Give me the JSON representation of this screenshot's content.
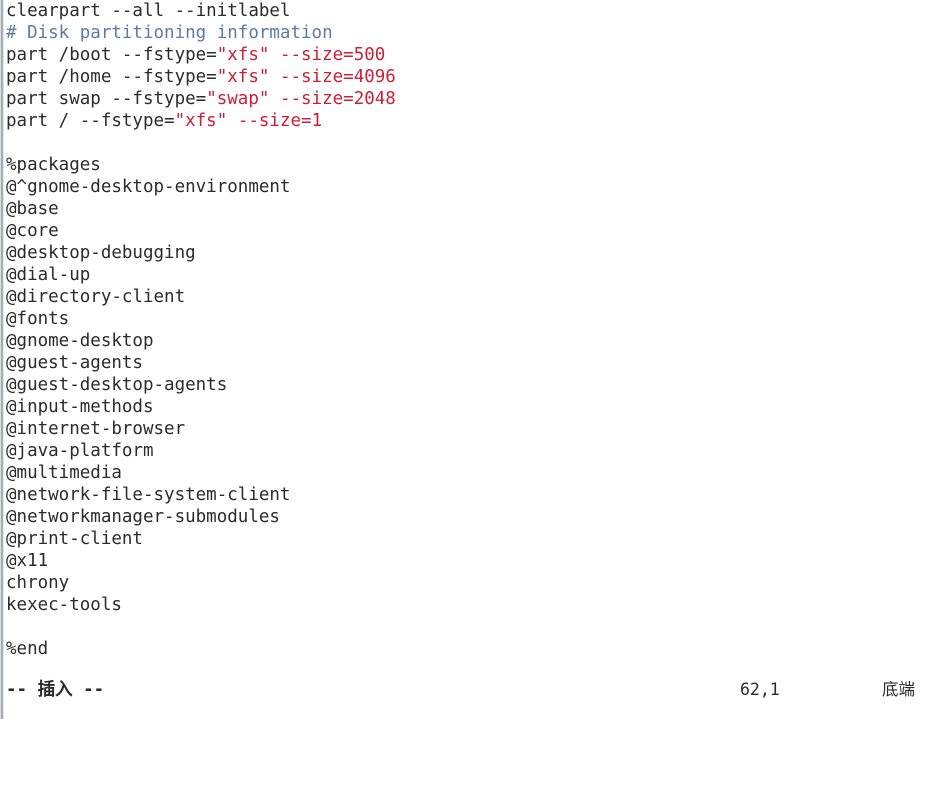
{
  "editor": {
    "name": "vim",
    "background_color": "#ffffff",
    "foreground_color": "#2b2b2b",
    "comment_color": "#5a7ca8",
    "string_color": "#cc1f36",
    "number_color": "#cc1f36",
    "gutter_color": "#8e969f"
  },
  "lines": [
    {
      "id": "line-1",
      "tokens": [
        {
          "text": "clearpart --all --initlabel",
          "type": "plain"
        }
      ]
    },
    {
      "id": "line-2",
      "tokens": [
        {
          "text": "# Disk partitioning information",
          "type": "comment"
        }
      ]
    },
    {
      "id": "line-3",
      "tokens": [
        {
          "text": "part /boot --fstype=",
          "type": "plain"
        },
        {
          "text": "\"xfs\"",
          "type": "string"
        },
        {
          "text": " ",
          "type": "plain"
        },
        {
          "text": "--size=500",
          "type": "number"
        }
      ]
    },
    {
      "id": "line-4",
      "tokens": [
        {
          "text": "part /home --fstype=",
          "type": "plain"
        },
        {
          "text": "\"xfs\"",
          "type": "string"
        },
        {
          "text": " ",
          "type": "plain"
        },
        {
          "text": "--size=4096",
          "type": "number"
        }
      ]
    },
    {
      "id": "line-5",
      "tokens": [
        {
          "text": "part swap --fstype=",
          "type": "plain"
        },
        {
          "text": "\"swap\"",
          "type": "string"
        },
        {
          "text": " ",
          "type": "plain"
        },
        {
          "text": "--size=2048",
          "type": "number"
        }
      ]
    },
    {
      "id": "line-6",
      "tokens": [
        {
          "text": "part / --fstype=",
          "type": "plain"
        },
        {
          "text": "\"xfs\"",
          "type": "string"
        },
        {
          "text": " ",
          "type": "plain"
        },
        {
          "text": "--size=1",
          "type": "number"
        }
      ]
    },
    {
      "id": "line-7",
      "tokens": [
        {
          "text": "",
          "type": "plain"
        }
      ]
    },
    {
      "id": "line-8",
      "tokens": [
        {
          "text": "%packages",
          "type": "plain"
        }
      ]
    },
    {
      "id": "line-9",
      "tokens": [
        {
          "text": "@^gnome-desktop-environment",
          "type": "plain"
        }
      ]
    },
    {
      "id": "line-10",
      "tokens": [
        {
          "text": "@base",
          "type": "plain"
        }
      ]
    },
    {
      "id": "line-11",
      "tokens": [
        {
          "text": "@core",
          "type": "plain"
        }
      ]
    },
    {
      "id": "line-12",
      "tokens": [
        {
          "text": "@desktop-debugging",
          "type": "plain"
        }
      ]
    },
    {
      "id": "line-13",
      "tokens": [
        {
          "text": "@dial-up",
          "type": "plain"
        }
      ]
    },
    {
      "id": "line-14",
      "tokens": [
        {
          "text": "@directory-client",
          "type": "plain"
        }
      ]
    },
    {
      "id": "line-15",
      "tokens": [
        {
          "text": "@fonts",
          "type": "plain"
        }
      ]
    },
    {
      "id": "line-16",
      "tokens": [
        {
          "text": "@gnome-desktop",
          "type": "plain"
        }
      ]
    },
    {
      "id": "line-17",
      "tokens": [
        {
          "text": "@guest-agents",
          "type": "plain"
        }
      ]
    },
    {
      "id": "line-18",
      "tokens": [
        {
          "text": "@guest-desktop-agents",
          "type": "plain"
        }
      ]
    },
    {
      "id": "line-19",
      "tokens": [
        {
          "text": "@input-methods",
          "type": "plain"
        }
      ]
    },
    {
      "id": "line-20",
      "tokens": [
        {
          "text": "@internet-browser",
          "type": "plain"
        }
      ]
    },
    {
      "id": "line-21",
      "tokens": [
        {
          "text": "@java-platform",
          "type": "plain"
        }
      ]
    },
    {
      "id": "line-22",
      "tokens": [
        {
          "text": "@multimedia",
          "type": "plain"
        }
      ]
    },
    {
      "id": "line-23",
      "tokens": [
        {
          "text": "@network-file-system-client",
          "type": "plain"
        }
      ]
    },
    {
      "id": "line-24",
      "tokens": [
        {
          "text": "@networkmanager-submodules",
          "type": "plain"
        }
      ]
    },
    {
      "id": "line-25",
      "tokens": [
        {
          "text": "@print-client",
          "type": "plain"
        }
      ]
    },
    {
      "id": "line-26",
      "tokens": [
        {
          "text": "@x11",
          "type": "plain"
        }
      ]
    },
    {
      "id": "line-27",
      "tokens": [
        {
          "text": "chrony",
          "type": "plain"
        }
      ]
    },
    {
      "id": "line-28",
      "tokens": [
        {
          "text": "kexec-tools",
          "type": "plain"
        }
      ]
    },
    {
      "id": "line-29",
      "tokens": [
        {
          "text": "",
          "type": "plain"
        }
      ]
    },
    {
      "id": "line-30",
      "tokens": [
        {
          "text": "%end",
          "type": "plain"
        }
      ]
    }
  ],
  "status": {
    "mode": "-- 插入 --",
    "ruler": "62,1",
    "position": "底端"
  }
}
